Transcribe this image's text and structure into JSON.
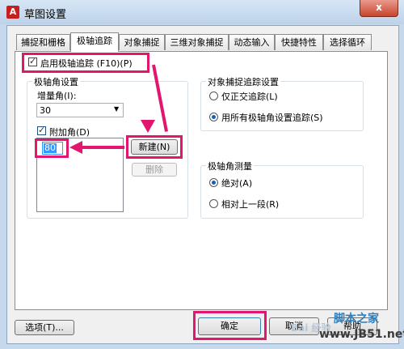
{
  "window": {
    "title": "草图设置",
    "app_icon_glyph": "A",
    "close_glyph": "x"
  },
  "tabs": [
    {
      "label": "捕捉和栅格"
    },
    {
      "label": "极轴追踪"
    },
    {
      "label": "对象捕捉"
    },
    {
      "label": "三维对象捕捉"
    },
    {
      "label": "动态输入"
    },
    {
      "label": "快捷特性"
    },
    {
      "label": "选择循环"
    }
  ],
  "polar": {
    "enable_label": "启用极轴追踪 (F10)(P)",
    "angle_settings_label": "极轴角设置",
    "increment_label": "增量角(I):",
    "increment_value": "30",
    "additional_label": "附加角(D)",
    "additional_value": "80",
    "new_button": "新建(N)",
    "delete_button": "删除"
  },
  "tracking": {
    "group_label": "对象捕捉追踪设置",
    "option_ortho": "仅正交追踪(L)",
    "option_all": "用所有极轴角设置追踪(S)"
  },
  "measurement": {
    "group_label": "极轴角测量",
    "option_absolute": "绝对(A)",
    "option_relative": "相对上一段(R)"
  },
  "footer": {
    "options_button": "选项(T)...",
    "ok_button": "确定",
    "cancel_button": "取消",
    "help_button": "帮助"
  },
  "watermark": {
    "site_name": "脚本之家",
    "site_url": "www.JB51.net",
    "baidu_text": "Bai 经验"
  },
  "colors": {
    "highlight": "#e2156f",
    "accent": "#1a5fb4"
  }
}
